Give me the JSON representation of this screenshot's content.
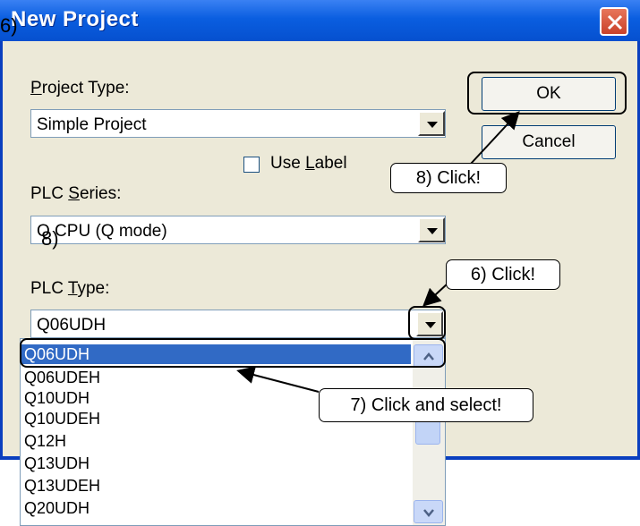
{
  "window": {
    "title": "New Project",
    "title_overlay_step": "6)",
    "close_icon": "close-icon"
  },
  "project_type": {
    "label_underlined": "P",
    "label_rest": "roject Type:",
    "value": "Simple Project"
  },
  "use_label": {
    "text_before": "Use ",
    "underlined": "L",
    "text_after": "abel",
    "checked": false
  },
  "plc_series": {
    "label_before": "PLC ",
    "underlined": "S",
    "label_after": "eries:",
    "value": "Q CPU (Q mode)",
    "overlay_step": "8)"
  },
  "plc_type": {
    "label_before": "PLC ",
    "underlined": "T",
    "label_after": "ype:",
    "value": "Q06UDH"
  },
  "buttons": {
    "ok": "OK",
    "cancel": "Cancel"
  },
  "dropdown_list": {
    "items": [
      "Q06UDH",
      "Q06UDEH",
      "Q10UDH",
      "Q10UDEH",
      "Q12H",
      "Q13UDH",
      "Q13UDEH",
      "Q20UDH"
    ],
    "selected_index": 0
  },
  "callouts": {
    "ok_click": "8) Click!",
    "type_click": "6) Click!",
    "select": "7) Click and select!"
  },
  "colors": {
    "title_bar": "#0a5ee0",
    "selection": "#316ac5",
    "dialog_bg": "#ece9d8"
  }
}
